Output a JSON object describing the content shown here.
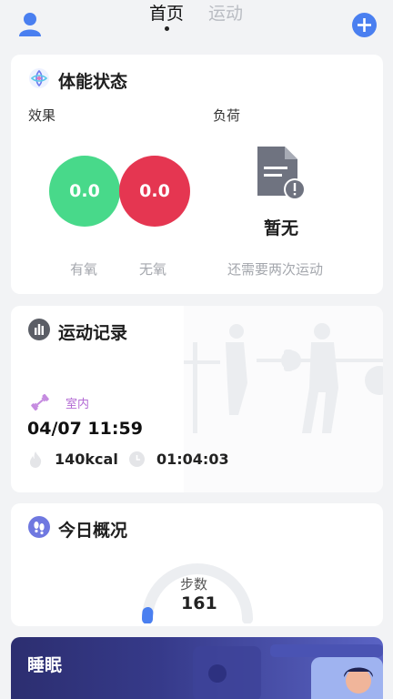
{
  "header": {
    "tabs": [
      {
        "label": "首页",
        "active": true
      },
      {
        "label": "运动",
        "active": false
      }
    ]
  },
  "fitness": {
    "title": "体能状态",
    "effect_label": "效果",
    "load_label": "负荷",
    "aerobic_value": "0.0",
    "anaerobic_value": "0.0",
    "aerobic_label": "有氧",
    "anaerobic_label": "无氧",
    "load_status": "暂无",
    "load_hint": "还需要两次运动",
    "colors": {
      "aerobic": "#48d98a",
      "anaerobic": "#e53651"
    }
  },
  "record": {
    "title": "运动记录",
    "type": "室内",
    "datetime": "04/07 11:59",
    "calories": "140kcal",
    "duration": "01:04:03"
  },
  "today": {
    "title": "今日概况",
    "steps_label": "步数",
    "steps_value": "161"
  },
  "sleep": {
    "title": "睡眠"
  },
  "icons": [
    "avatar-icon",
    "add-icon",
    "fitness-logo-icon",
    "chart-icon",
    "dumbbell-icon",
    "flame-icon",
    "clock-icon",
    "footprint-icon",
    "document-warning-icon"
  ]
}
